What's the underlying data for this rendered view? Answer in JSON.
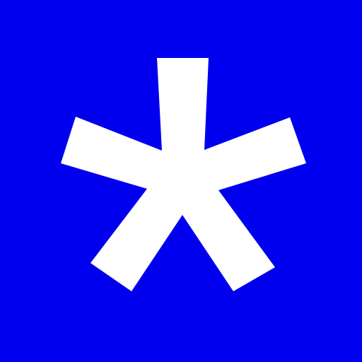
{
  "icon": {
    "name": "asterisk-icon",
    "background_color": "#0000ee",
    "glyph_color": "#ffffff"
  }
}
